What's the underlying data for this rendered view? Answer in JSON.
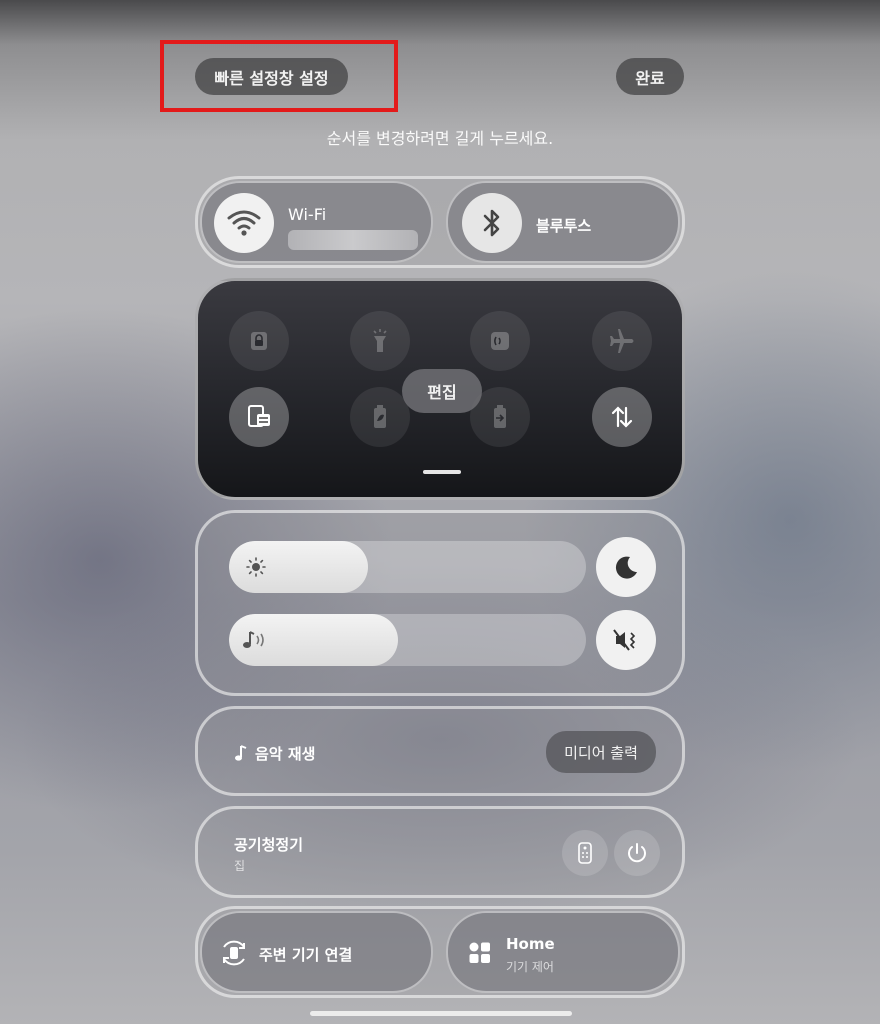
{
  "header": {
    "title": "빠른 설정창 설정",
    "done_label": "완료",
    "hint": "순서를 변경하려면 길게 누르세요."
  },
  "connectivity": {
    "wifi_label": "Wi-Fi",
    "bluetooth_label": "블루투스"
  },
  "quick_panel": {
    "edit_label": "편집",
    "icons_row1": [
      "lock-screen-icon",
      "flashlight-icon",
      "nfc-icon",
      "airplane-icon"
    ],
    "icons_row2": [
      "card-icon",
      "power-saving-icon",
      "battery-share-icon",
      "mobile-data-icon"
    ]
  },
  "sliders": {
    "brightness_level": 0.388,
    "volume_level": 0.474
  },
  "media": {
    "label": "음악 재생",
    "output_label": "미디어 출력"
  },
  "device": {
    "name": "공기청정기",
    "location": "집"
  },
  "bottom": {
    "nearby_label": "주변 기기 연결",
    "home_label": "Home",
    "home_sub": "기기 제어"
  },
  "colors": {
    "highlight": "#e31a1a",
    "wifi_active": "#f1f1f1"
  }
}
